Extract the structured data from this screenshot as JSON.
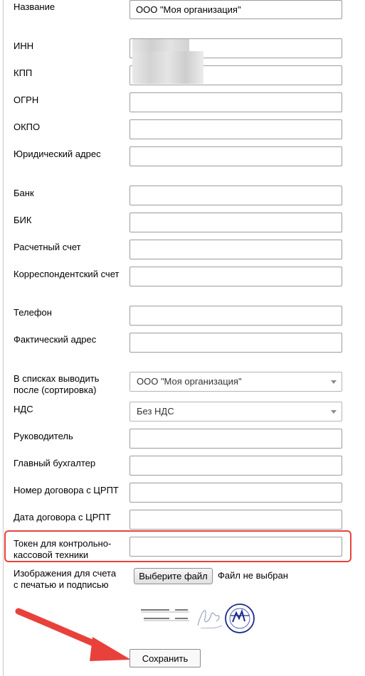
{
  "form": {
    "name_label": "Название",
    "name_value": "ООО \"Моя организация\"",
    "inn_label": "ИНН",
    "kpp_label": "КПП",
    "ogrn_label": "ОГРН",
    "okpo_label": "ОКПО",
    "legal_address_label": "Юридический адрес",
    "bank_label": "Банк",
    "bik_label": "БИК",
    "account_label": "Расчетный счет",
    "corr_account_label": "Корреспондентский счет",
    "phone_label": "Телефон",
    "actual_address_label": "Фактический адрес",
    "sort_label_line1": "В списках выводить",
    "sort_label_line2": "после (сортировка)",
    "sort_value": "ООО \"Моя организация\"",
    "vat_label": "НДС",
    "vat_value": "Без НДС",
    "director_label": "Руководитель",
    "accountant_label": "Главный бухгалтер",
    "crpt_contract_number_label": "Номер договора с ЦРПТ",
    "crpt_contract_date_label": "Дата договора с ЦРПТ",
    "kkt_token_label_line1": "Токен для контрольно-",
    "kkt_token_label_line2": "кассовой техники",
    "images_label_line1": "Изображения для счета",
    "images_label_line2": "с печатью и подписью",
    "file_button_label": "Выберите файл",
    "file_status": "Файл не выбран",
    "save_label": "Сохранить"
  },
  "colors": {
    "highlight": "#e8413c",
    "arrow": "#e8413c",
    "stamp": "#1a2a8c"
  },
  "icons": {
    "sort_select": "chevron-down-icon",
    "vat_select": "chevron-down-icon"
  }
}
